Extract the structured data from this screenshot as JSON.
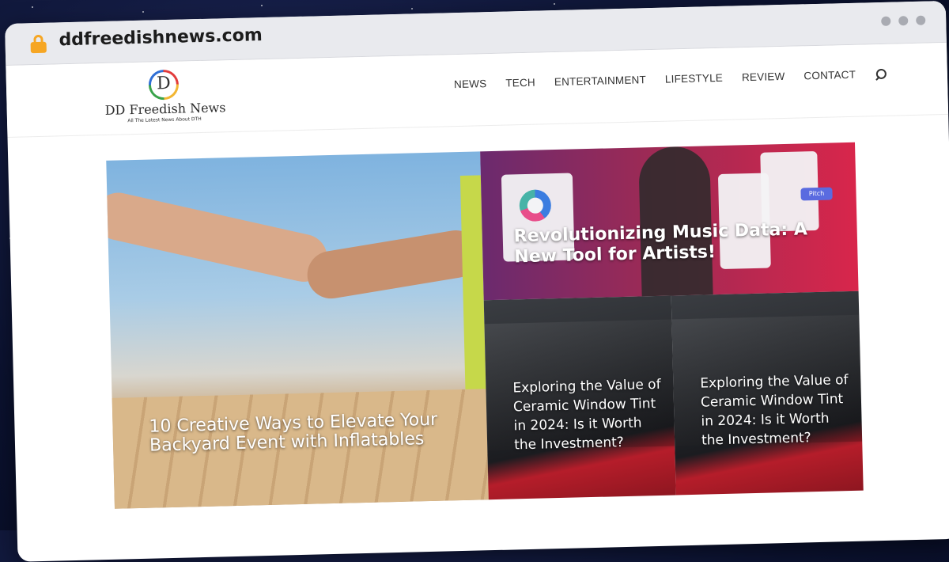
{
  "browser": {
    "url": "ddfreedishnews.com"
  },
  "site": {
    "logo_letter": "D",
    "logo_name": "DD Freedish News",
    "logo_tagline": "All The Latest News About DTH"
  },
  "nav": {
    "items": [
      "NEWS",
      "TECH",
      "ENTERTAINMENT",
      "LIFESTYLE",
      "REVIEW",
      "CONTACT"
    ]
  },
  "featured": {
    "main": {
      "title": "10 Creative Ways to Elevate Your Backyard Event with Inflatables"
    },
    "top_right": {
      "title": "Revolutionizing Music Data: A New Tool for Artists!",
      "pitch_label": "Pitch"
    },
    "bottom_left": {
      "title": "Exploring the Value of Ceramic Window Tint in 2024: Is it Worth the Investment?"
    },
    "bottom_right": {
      "title": "Exploring the Value of Ceramic Window Tint in 2024: Is it Worth the Investment?"
    }
  },
  "colors": {
    "lock": "#f6a623",
    "chrome": "#e9eaee",
    "background": "#0b1230"
  }
}
